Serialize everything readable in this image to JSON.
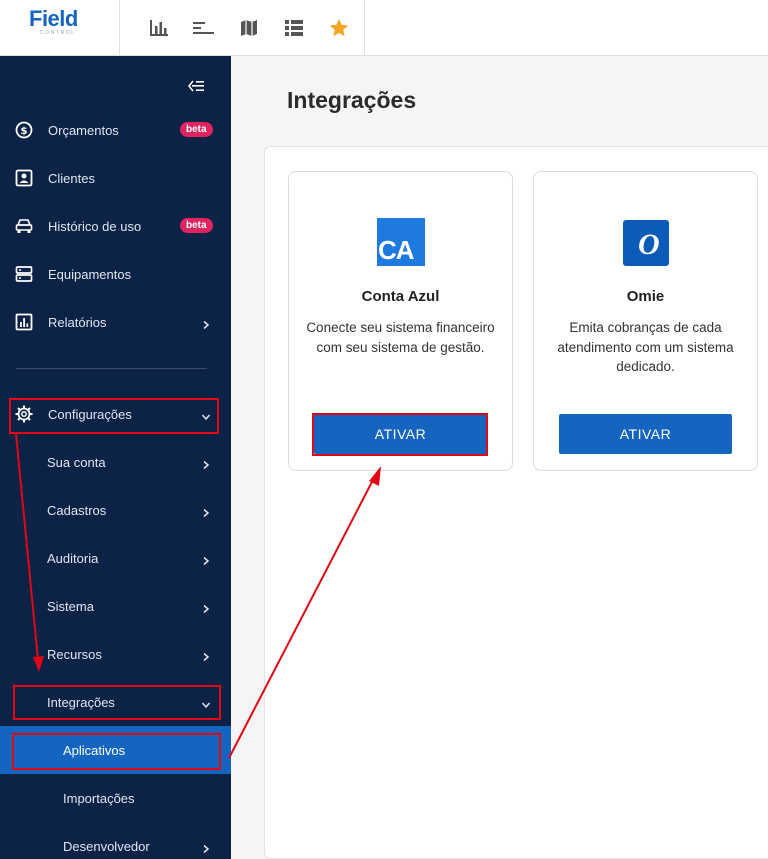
{
  "brand": {
    "name": "Field",
    "tagline": "CONTROL"
  },
  "toolbar": {
    "icons": [
      "bar-chart-icon",
      "list-sort-icon",
      "map-icon",
      "list-icon",
      "star-icon"
    ],
    "star_color": "#f5a623"
  },
  "sidebar": {
    "items": [
      {
        "label": "Orçamentos",
        "icon": "dollar-circle-icon",
        "badge": "beta"
      },
      {
        "label": "Clientes",
        "icon": "contact-card-icon"
      },
      {
        "label": "Histórico de uso",
        "icon": "car-icon",
        "badge": "beta"
      },
      {
        "label": "Equipamentos",
        "icon": "server-icon"
      },
      {
        "label": "Relatórios",
        "icon": "report-chart-icon"
      }
    ],
    "config": {
      "label": "Configurações",
      "children": [
        {
          "label": "Sua conta"
        },
        {
          "label": "Cadastros"
        },
        {
          "label": "Auditoria"
        },
        {
          "label": "Sistema"
        },
        {
          "label": "Recursos"
        }
      ],
      "integracoes": {
        "label": "Integrações",
        "children": [
          {
            "label": "Aplicativos",
            "active": true
          },
          {
            "label": "Importações"
          },
          {
            "label": "Desenvolvedor"
          }
        ]
      }
    }
  },
  "main": {
    "title": "Integrações",
    "cards": [
      {
        "logo": "CA",
        "title": "Conta Azul",
        "description": "Conecte seu sistema financeiro com seu sistema de gestão.",
        "button": "ATIVAR"
      },
      {
        "logo": "O",
        "title": "Omie",
        "description": "Emita cobranças de cada atendimento com um sistema dedicado.",
        "button": "ATIVAR"
      }
    ]
  },
  "colors": {
    "sidebar": "#0d2346",
    "accent": "#1565c0",
    "annotation": "#e30613",
    "badge": "#e0245e"
  }
}
